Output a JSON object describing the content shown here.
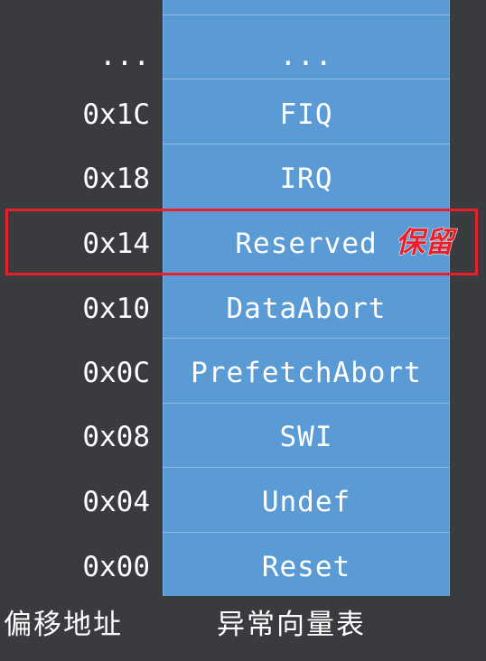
{
  "rows": [
    {
      "offset": "...",
      "vector": "..."
    },
    {
      "offset": "0x1C",
      "vector": "FIQ"
    },
    {
      "offset": "0x18",
      "vector": "IRQ"
    },
    {
      "offset": "0x14",
      "vector": "Reserved"
    },
    {
      "offset": "0x10",
      "vector": "DataAbort"
    },
    {
      "offset": "0x0C",
      "vector": "PrefetchAbort"
    },
    {
      "offset": "0x08",
      "vector": "SWI"
    },
    {
      "offset": "0x04",
      "vector": "Undef"
    },
    {
      "offset": "0x00",
      "vector": "Reset"
    }
  ],
  "annotation": {
    "label": "保留",
    "color": "#e8202a"
  },
  "footer": {
    "offset_label": "偏移地址",
    "table_label": "异常向量表"
  },
  "colors": {
    "background": "#3a3b3f",
    "table_fill": "#5b9bd5",
    "text": "#ffffff"
  }
}
